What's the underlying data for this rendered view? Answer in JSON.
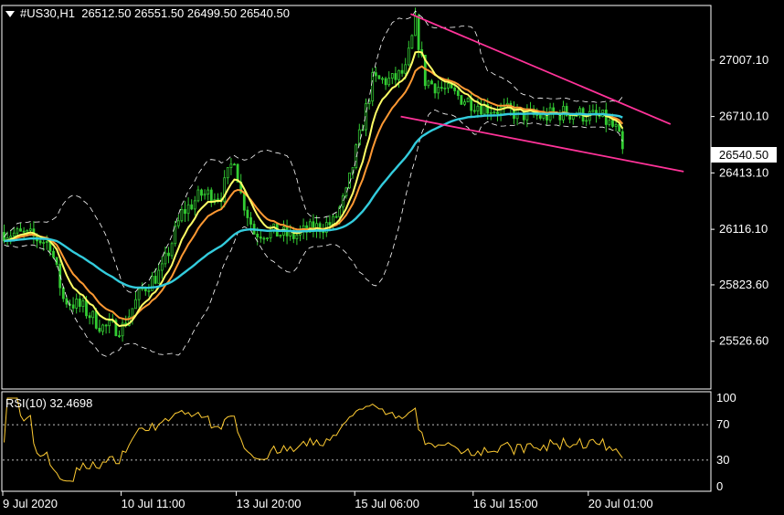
{
  "header": {
    "symbol": "#US30,H1",
    "ohlc": "26512.50 26551.50 26499.50 26540.50"
  },
  "current_price_label": "26540.50",
  "rsi_header": "RSI(10) 32.4698",
  "colors": {
    "background": "#000000",
    "candles": "#33cc33",
    "ema_fast": "#ffff66",
    "ema_mid": "#ff9933",
    "ma_slow": "#33ccdd",
    "bollinger": "#ffffff",
    "trendlines": "#ff3399",
    "rsi_line": "#ffcc33",
    "grid": "#ffffff"
  },
  "chart_data": [
    {
      "type": "candlestick",
      "x_tick_labels": [
        "9 Jul 2020",
        "10 Jul 11:00",
        "13 Jul 20:00",
        "15 Jul 06:00",
        "16 Jul 15:00",
        "20 Jul 01:00"
      ],
      "y_tick_labels": [
        "27007.10",
        "26710.10",
        "26413.10",
        "26116.10",
        "25823.60",
        "25526.60"
      ],
      "y_ticks": [
        27007.1,
        26710.1,
        26413.1,
        26116.1,
        25823.6,
        25526.6
      ],
      "ylim": [
        25280,
        27290
      ],
      "last_price": 26540.5,
      "price_path": [
        [
          0,
          26100
        ],
        [
          8,
          26080
        ],
        [
          14,
          26040
        ],
        [
          18,
          25750
        ],
        [
          24,
          25700
        ],
        [
          30,
          25600
        ],
        [
          36,
          25600
        ],
        [
          42,
          25800
        ],
        [
          48,
          25900
        ],
        [
          54,
          26200
        ],
        [
          60,
          26300
        ],
        [
          66,
          26300
        ],
        [
          70,
          26500
        ],
        [
          72,
          26300
        ],
        [
          76,
          26100
        ],
        [
          82,
          26100
        ],
        [
          88,
          26080
        ],
        [
          94,
          26120
        ],
        [
          100,
          26150
        ],
        [
          104,
          26300
        ],
        [
          108,
          26600
        ],
        [
          112,
          26900
        ],
        [
          118,
          26900
        ],
        [
          122,
          26950
        ],
        [
          125,
          27200
        ],
        [
          128,
          26900
        ],
        [
          134,
          26850
        ],
        [
          140,
          26800
        ],
        [
          146,
          26760
        ],
        [
          152,
          26740
        ],
        [
          158,
          26720
        ],
        [
          164,
          26710
        ],
        [
          170,
          26730
        ],
        [
          176,
          26720
        ],
        [
          182,
          26700
        ],
        [
          186,
          26640
        ],
        [
          188,
          26540
        ]
      ],
      "trendlines": [
        {
          "from": [
            124,
            27250
          ],
          "to": [
            203,
            26670
          ]
        },
        {
          "from": [
            121,
            26710
          ],
          "to": [
            207,
            26420
          ]
        }
      ]
    },
    {
      "type": "line",
      "name": "RSI(10)",
      "value": 32.4698,
      "y_tick_labels": [
        "100",
        "70",
        "30",
        "0"
      ],
      "levels": [
        70,
        30
      ],
      "ylim": [
        0,
        100
      ]
    }
  ]
}
